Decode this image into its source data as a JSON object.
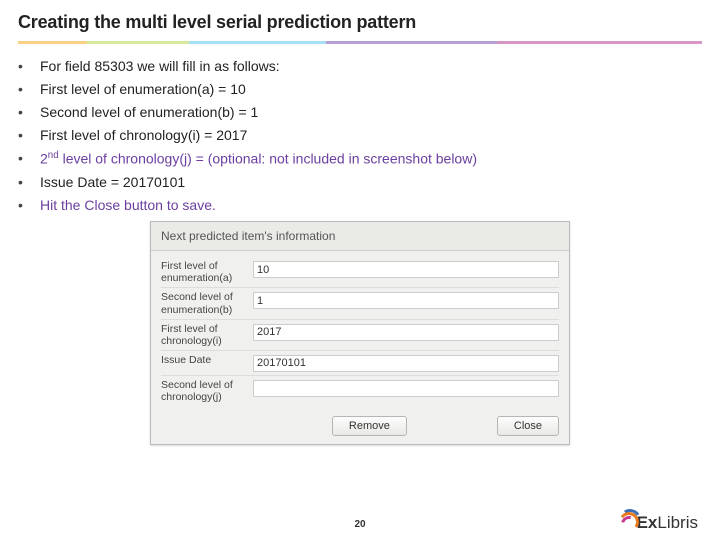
{
  "title": "Creating the multi level serial prediction pattern",
  "bullets": [
    {
      "text": "For field 85303 we will fill in as follows:",
      "purple": false
    },
    {
      "text": "First level of enumeration(a) = 10",
      "purple": false
    },
    {
      "text": "Second level of enumeration(b) = 1",
      "purple": false
    },
    {
      "text": "First level of chronology(i) = 2017",
      "purple": false
    },
    {
      "text": "2nd level of chronology(j) = (optional: not included in screenshot below)",
      "purple": true,
      "sup": true
    },
    {
      "text": "Issue Date = 20170101",
      "purple": false
    },
    {
      "text": "Hit the Close button to save.",
      "purple": true
    }
  ],
  "panel": {
    "header": "Next predicted item's information",
    "rows": [
      {
        "label": "First level of enumeration(a)",
        "value": "10"
      },
      {
        "label": "Second level of enumeration(b)",
        "value": "1"
      },
      {
        "label": "First level of chronology(i)",
        "value": "2017"
      },
      {
        "label": "Issue Date",
        "value": "20170101"
      },
      {
        "label": "Second level of chronology(j)",
        "value": ""
      }
    ],
    "buttons": {
      "remove": "Remove",
      "close": "Close"
    }
  },
  "page_number": "20",
  "logo": {
    "bold": "Ex",
    "rest": "Libris"
  }
}
